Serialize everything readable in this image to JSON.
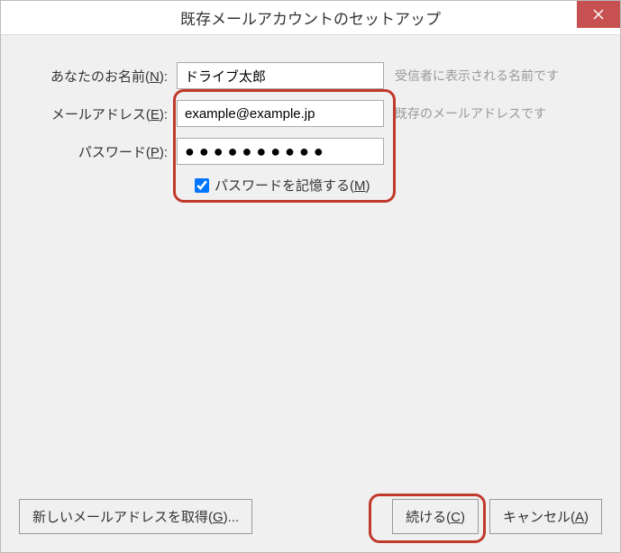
{
  "title": "既存メールアカウントのセットアップ",
  "form": {
    "name": {
      "label_pre": "あなたのお名前(",
      "label_key": "N",
      "label_post": "):",
      "value": "ドライブ太郎",
      "hint": "受信者に表示される名前です"
    },
    "email": {
      "label_pre": "メールアドレス(",
      "label_key": "E",
      "label_post": "):",
      "value": "example@example.jp",
      "hint": "既存のメールアドレスです"
    },
    "password": {
      "label_pre": "パスワード(",
      "label_key": "P",
      "label_post": "):",
      "value": "●●●●●●●●●●"
    },
    "remember": {
      "label_pre": "パスワードを記憶する(",
      "label_key": "M",
      "label_post": ")",
      "checked": true
    }
  },
  "buttons": {
    "new_address": {
      "label_pre": "新しいメールアドレスを取得(",
      "label_key": "G",
      "label_post": ")..."
    },
    "continue": {
      "label_pre": "続ける(",
      "label_key": "C",
      "label_post": ")"
    },
    "cancel": {
      "label_pre": "キャンセル(",
      "label_key": "A",
      "label_post": ")"
    }
  }
}
